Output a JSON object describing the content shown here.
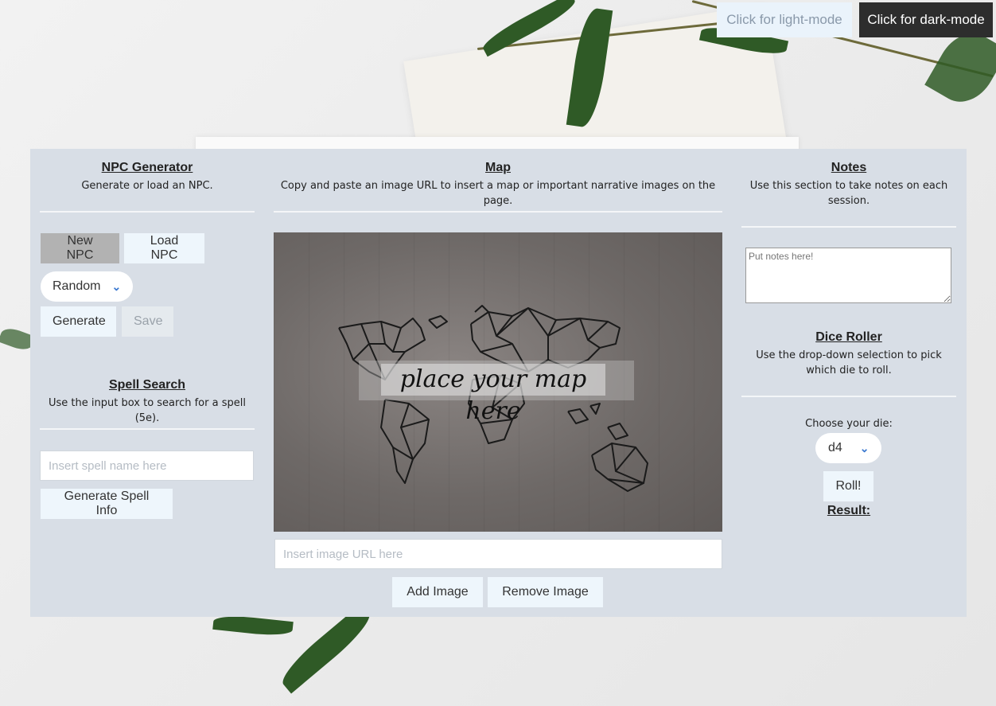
{
  "mode_buttons": {
    "light": "Click for light-mode",
    "dark": "Click for dark-mode"
  },
  "npc": {
    "title": "NPC Generator",
    "description": "Generate or load an NPC.",
    "new_npc": "New NPC",
    "load_npc": "Load NPC",
    "type_select": "Random",
    "generate": "Generate",
    "save": "Save"
  },
  "spell": {
    "title": "Spell Search",
    "description": "Use the input box to search for a spell (5e).",
    "input_placeholder": "Insert spell name here",
    "generate": "Generate Spell Info"
  },
  "map": {
    "title": "Map",
    "description": "Copy and paste an image URL to insert a map or important narrative images on the page.",
    "placeholder_text": "place your map here",
    "url_placeholder": "Insert image URL here",
    "add": "Add Image",
    "remove": "Remove Image"
  },
  "notes": {
    "title": "Notes",
    "description": "Use this section to take notes on each session.",
    "placeholder": "Put notes here!"
  },
  "dice": {
    "title": "Dice Roller",
    "description": "Use the drop-down selection to pick which die to roll.",
    "choose_label": "Choose your die:",
    "die": "d4",
    "roll": "Roll!",
    "result_label": "Result:"
  },
  "icons": {
    "dropdown": "chevron-down-icon"
  }
}
